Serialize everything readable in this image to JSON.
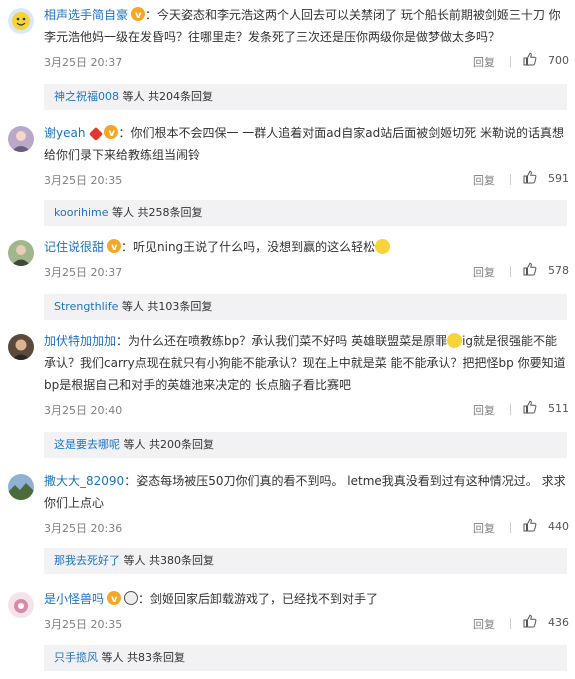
{
  "comments": [
    {
      "user": "相声选手简自豪",
      "text": "：今天姿态和李元浩这两个人回去可以关禁闭了 玩个船长前期被剑姬三十刀 你李元浩他妈一级在发昏吗？往哪里走？发条死了三次还是压你两级你是做梦做太多吗？",
      "time": "3月25日 20:37",
      "reply_label": "回复",
      "likes": "700",
      "sub_user": "神之祝福008",
      "sub_count": "等人 共204条回复"
    },
    {
      "user": "谢yeah",
      "text": "：你们根本不会四保一 一群人追着对面ad自家ad站后面被剑姬切死 米勒说的话真想给你们录下来给教练组当闹铃",
      "time": "3月25日 20:35",
      "reply_label": "回复",
      "likes": "591",
      "sub_user": "koorihime",
      "sub_count": "等人 共258条回复"
    },
    {
      "user": "记住说很甜",
      "text": "：听见ning王说了什么吗，没想到赢的这么轻松",
      "time": "3月25日 20:37",
      "reply_label": "回复",
      "likes": "578",
      "sub_user": "Strengthlife",
      "sub_count": "等人 共103条回复"
    },
    {
      "user": "加伏特加加加",
      "text_a": "：为什么还在喷教练bp？承认我们菜不好吗 英雄联盟菜是原罪",
      "text_b": "ig就是很强能不能承认？我们carry点现在就只有小狗能不能承认？现在上中就是菜 能不能承认？把把怪bp 你要知道bp是根据自己和对手的英雄池来决定的 长点脑子看比赛吧",
      "time": "3月25日 20:40",
      "reply_label": "回复",
      "likes": "511",
      "sub_user": "这是要去哪呢",
      "sub_count": "等人 共200条回复"
    },
    {
      "user": "撒大大_82090",
      "text": "：姿态每场被压50刀你们真的看不到吗。 letme我真没看到过有这种情况过。 求求你们上点心",
      "time": "3月25日 20:36",
      "reply_label": "回复",
      "likes": "440",
      "sub_user": "那我去死好了",
      "sub_count": "等人 共380条回复"
    },
    {
      "user": "是小怪兽吗",
      "text": "：剑姬回家后卸载游戏了，已经找不到对手了",
      "time": "3月25日 20:35",
      "reply_label": "回复",
      "likes": "436",
      "sub_user": "只手揽风",
      "sub_count": "等人 共83条回复"
    }
  ],
  "colors": {
    "link": "#1a73c5",
    "meta": "#808080",
    "reply_bg": "#f2f2f5"
  }
}
